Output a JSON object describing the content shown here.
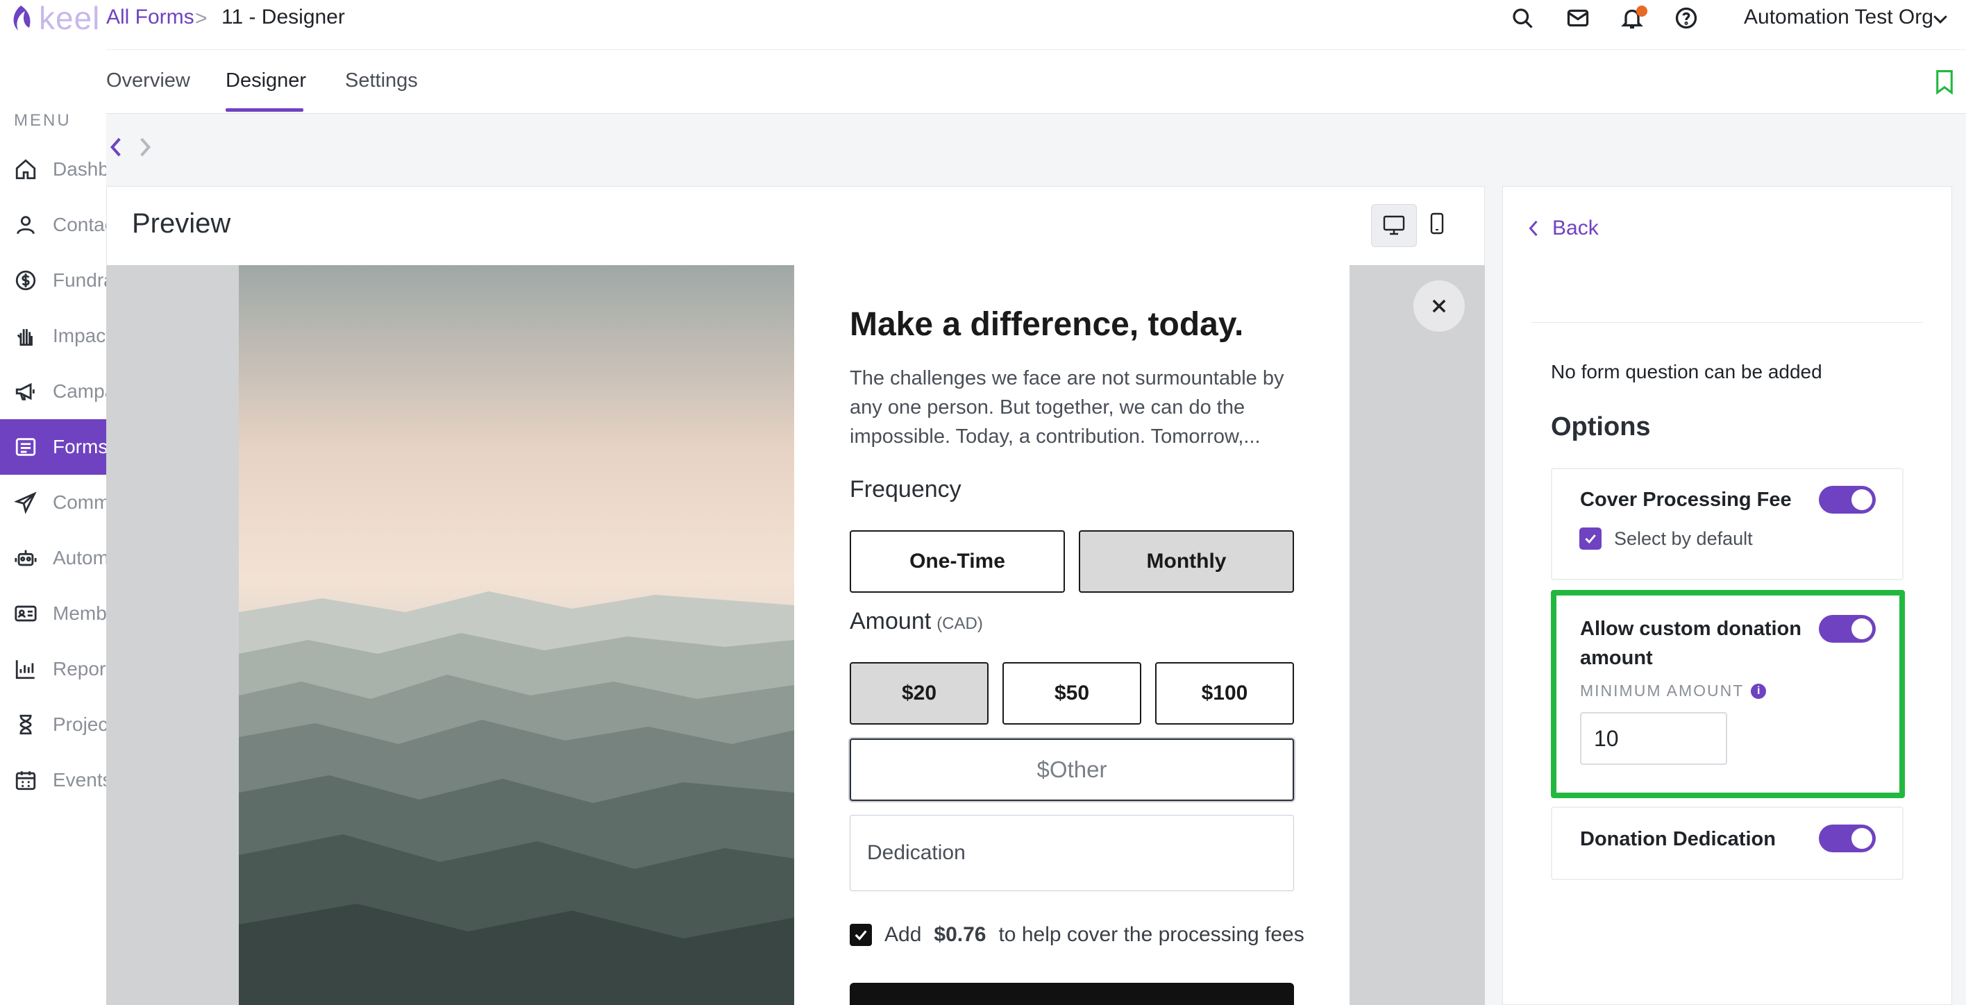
{
  "app": {
    "logo_text": "keel",
    "org_name": "Automation Test Org"
  },
  "breadcrumb": {
    "parent": "All Forms",
    "separator": ">",
    "current": "11 - Designer"
  },
  "sidebar": {
    "menu_title": "MENU",
    "items": [
      {
        "label": "Dashboard",
        "icon": "home-icon"
      },
      {
        "label": "Contacts",
        "icon": "person-icon"
      },
      {
        "label": "Fundraising",
        "icon": "dollar-circle-icon"
      },
      {
        "label": "Impact",
        "icon": "hand-icon"
      },
      {
        "label": "Campaigns",
        "icon": "megaphone-icon"
      },
      {
        "label": "Forms",
        "icon": "list-icon",
        "active": true
      },
      {
        "label": "Communications",
        "icon": "paper-plane-icon"
      },
      {
        "label": "Automations",
        "icon": "robot-icon"
      },
      {
        "label": "Memberships",
        "icon": "id-card-icon"
      },
      {
        "label": "Reports",
        "icon": "bar-chart-icon"
      },
      {
        "label": "Projects",
        "icon": "hourglass-icon"
      },
      {
        "label": "Events",
        "icon": "calendar-icon"
      }
    ]
  },
  "tabs": {
    "overview": "Overview",
    "designer": "Designer",
    "settings": "Settings"
  },
  "preview": {
    "title": "Preview",
    "form": {
      "title": "Make a difference, today.",
      "description": "The challenges we face are not surmountable by any one person. But together, we can do the impossible. Today, a contribution. Tomorrow,...",
      "frequency_label": "Frequency",
      "frequency_options": [
        "One-Time",
        "Monthly"
      ],
      "frequency_selected": "Monthly",
      "amount_label": "Amount",
      "amount_currency": "(CAD)",
      "amount_options": [
        "$20",
        "$50",
        "$100"
      ],
      "amount_selected": "$20",
      "other_placeholder": "$Other",
      "dedication_placeholder": "Dedication",
      "fee_prefix": "Add",
      "fee_amount": "$0.76",
      "fee_suffix": "to help cover the processing fees"
    }
  },
  "options_panel": {
    "back": "Back",
    "no_question": "No form question can be added",
    "title": "Options",
    "cover_fee": {
      "label": "Cover Processing Fee",
      "enabled": true,
      "select_default_label": "Select by default",
      "select_default_checked": true
    },
    "custom_amount": {
      "label": "Allow custom donation amount",
      "enabled": true,
      "min_label": "MINIMUM AMOUNT",
      "min_value": "10"
    },
    "dedication": {
      "label": "Donation Dedication",
      "enabled": true
    }
  },
  "colors": {
    "accent": "#6f42c1",
    "highlight": "#22b83f",
    "notification": "#e86a25"
  }
}
